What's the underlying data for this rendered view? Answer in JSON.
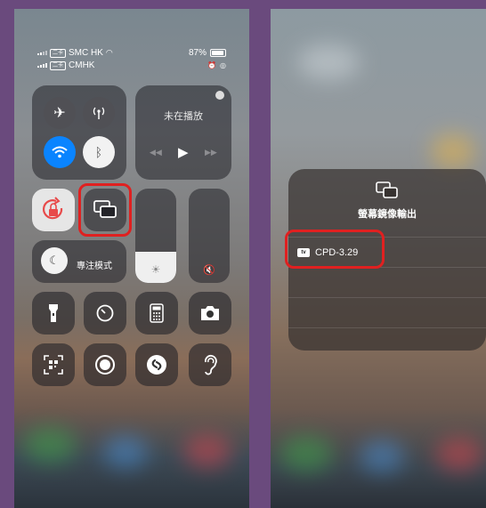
{
  "left_screen": {
    "status_bar": {
      "carrier_1": "SMC HK",
      "carrier_2": "CMHK",
      "battery": "87%",
      "sim_badge": "二卡"
    },
    "music": {
      "title": "未在播放"
    },
    "focus": {
      "label": "專注模式"
    },
    "controls": [
      "airplane-mode",
      "cellular-data",
      "wifi",
      "bluetooth",
      "orientation-lock",
      "screen-mirroring",
      "brightness",
      "volume-muted",
      "flashlight",
      "timer",
      "calculator",
      "camera",
      "code-scanner",
      "screen-recording",
      "shazam",
      "hearing"
    ],
    "brightness_level": 0.33,
    "colors": {
      "wifi_blue": "#0a84ff",
      "highlight": "#e02020",
      "orientation_red": "#e84a4a"
    }
  },
  "right_screen": {
    "mirror_panel": {
      "title": "螢幕鏡像輸出",
      "device": {
        "badge": "tv",
        "name": "CPD-3.29"
      }
    }
  }
}
